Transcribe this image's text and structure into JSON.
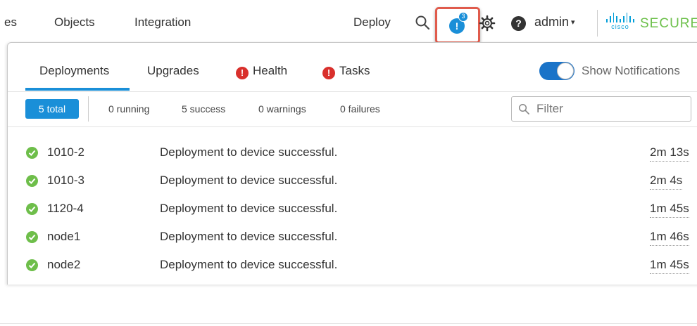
{
  "topnav": {
    "items": [
      "es",
      "Objects",
      "Integration"
    ],
    "deploy_label": "Deploy",
    "notification_count": "3",
    "notification_glyph": "!",
    "help_glyph": "?",
    "user_label": "admin",
    "caret": "▾",
    "logo_word": "cisco",
    "brand_label": "SECURE",
    "colors": {
      "accent": "#1a8fd8",
      "highlight_border": "#e05b4c",
      "brand_green": "#6cc04a"
    }
  },
  "panel": {
    "tabs": [
      {
        "label": "Deployments",
        "active": true
      },
      {
        "label": "Upgrades"
      },
      {
        "label": "Health",
        "icon": "alert-icon"
      },
      {
        "label": "Tasks",
        "icon": "alert-icon"
      }
    ],
    "alert_glyph": "!",
    "toggle_label": "Show Notifications",
    "toggle_on": true,
    "filters": {
      "total": "5 total",
      "running": "0 running",
      "success": "5 success",
      "warnings": "0 warnings",
      "failures": "0 failures",
      "search_placeholder": "Filter"
    },
    "rows": [
      {
        "device": "1010-2",
        "message": "Deployment to device successful.",
        "duration": "2m 13s"
      },
      {
        "device": "1010-3",
        "message": "Deployment to device successful.",
        "duration": "2m 4s"
      },
      {
        "device": "1120-4",
        "message": "Deployment to device successful.",
        "duration": "1m 45s"
      },
      {
        "device": "node1",
        "message": "Deployment to device successful.",
        "duration": "1m 46s"
      },
      {
        "device": "node2",
        "message": "Deployment to device successful.",
        "duration": "1m 45s"
      }
    ],
    "colors": {
      "success": "#6ebe4a",
      "error": "#d9302c",
      "toggle": "#1a73c8"
    }
  }
}
